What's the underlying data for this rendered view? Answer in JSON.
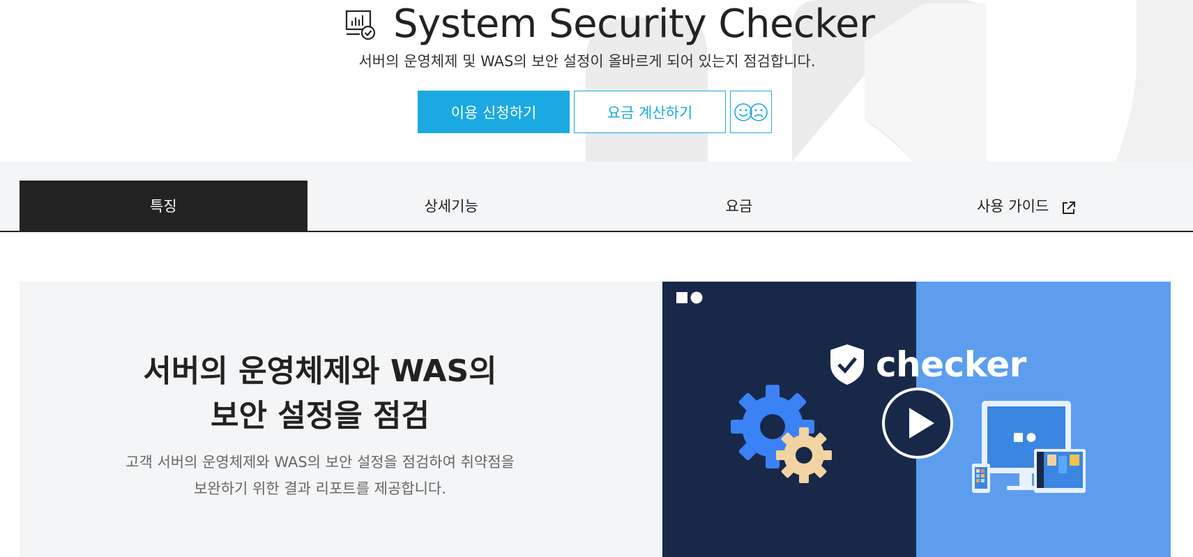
{
  "hero": {
    "title": "System Security Checker",
    "subtitle": "서버의 운영체제 및 WAS의 보안 설정이 올바르게 되어 있는지 점검합니다.",
    "apply_button": "이용 신청하기",
    "calc_button": "요금 계산하기",
    "feedback_icon": "smile-frown-icon",
    "product_icon": "monitor-check-icon"
  },
  "tabs": [
    {
      "label": "특징",
      "active": true
    },
    {
      "label": "상세기능",
      "active": false
    },
    {
      "label": "요금",
      "active": false
    },
    {
      "label": "사용 가이드",
      "active": false,
      "icon": "external-link-icon"
    }
  ],
  "feature": {
    "headline_line1": "서버의 운영체제와 WAS의",
    "headline_line2": "보안 설정을 점검",
    "desc_line1": "고객 서버의 운영체제와 WAS의 보안 설정을 점검하여 취약점을",
    "desc_line2": "보완하기 위한 결과 리포트를 제공합니다."
  },
  "video": {
    "logo_text": "checker",
    "icons": [
      "brand-logo-icon",
      "shield-check-icon",
      "gears-icon",
      "play-icon",
      "devices-icon"
    ]
  },
  "colors": {
    "accent": "#1ba9e1",
    "tab_active_bg": "#222222",
    "panel_bg": "#f4f5f7",
    "video_dark": "#182848",
    "video_light": "#5c9dee",
    "gear_blue": "#3b82f6",
    "gear_beige": "#f2d3a2"
  }
}
